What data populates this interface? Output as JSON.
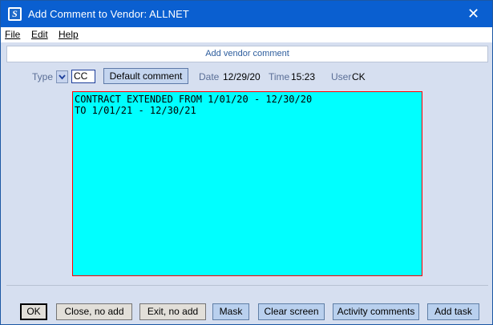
{
  "window": {
    "title": "Add Comment to Vendor:  ALLNET",
    "icon": "S",
    "close_glyph": "✕"
  },
  "menu": {
    "items": [
      {
        "label": "File"
      },
      {
        "label": "Edit"
      },
      {
        "label": "Help"
      }
    ]
  },
  "section": {
    "header": "Add vendor comment"
  },
  "fields": {
    "type_label": "Type",
    "type_value": "CC",
    "default_button": "Default comment",
    "date_label": "Date",
    "date_value": "12/29/20",
    "time_label": "Time",
    "time_value": "15:23",
    "user_label": "User",
    "user_value": "CK"
  },
  "comment": {
    "text": "CONTRACT EXTENDED FROM 1/01/20 - 12/30/20\nTO 1/01/21 - 12/30/21"
  },
  "buttons": {
    "ok": "OK",
    "close_no_add": "Close, no add",
    "exit_no_add": "Exit, no add",
    "mask": "Mask",
    "clear_screen": "Clear screen",
    "activity_comments": "Activity comments",
    "add_task": "Add task"
  },
  "colors": {
    "titlebar": "#0a5fd0",
    "comment_bg": "#00ffff",
    "comment_border": "#ff0000"
  }
}
